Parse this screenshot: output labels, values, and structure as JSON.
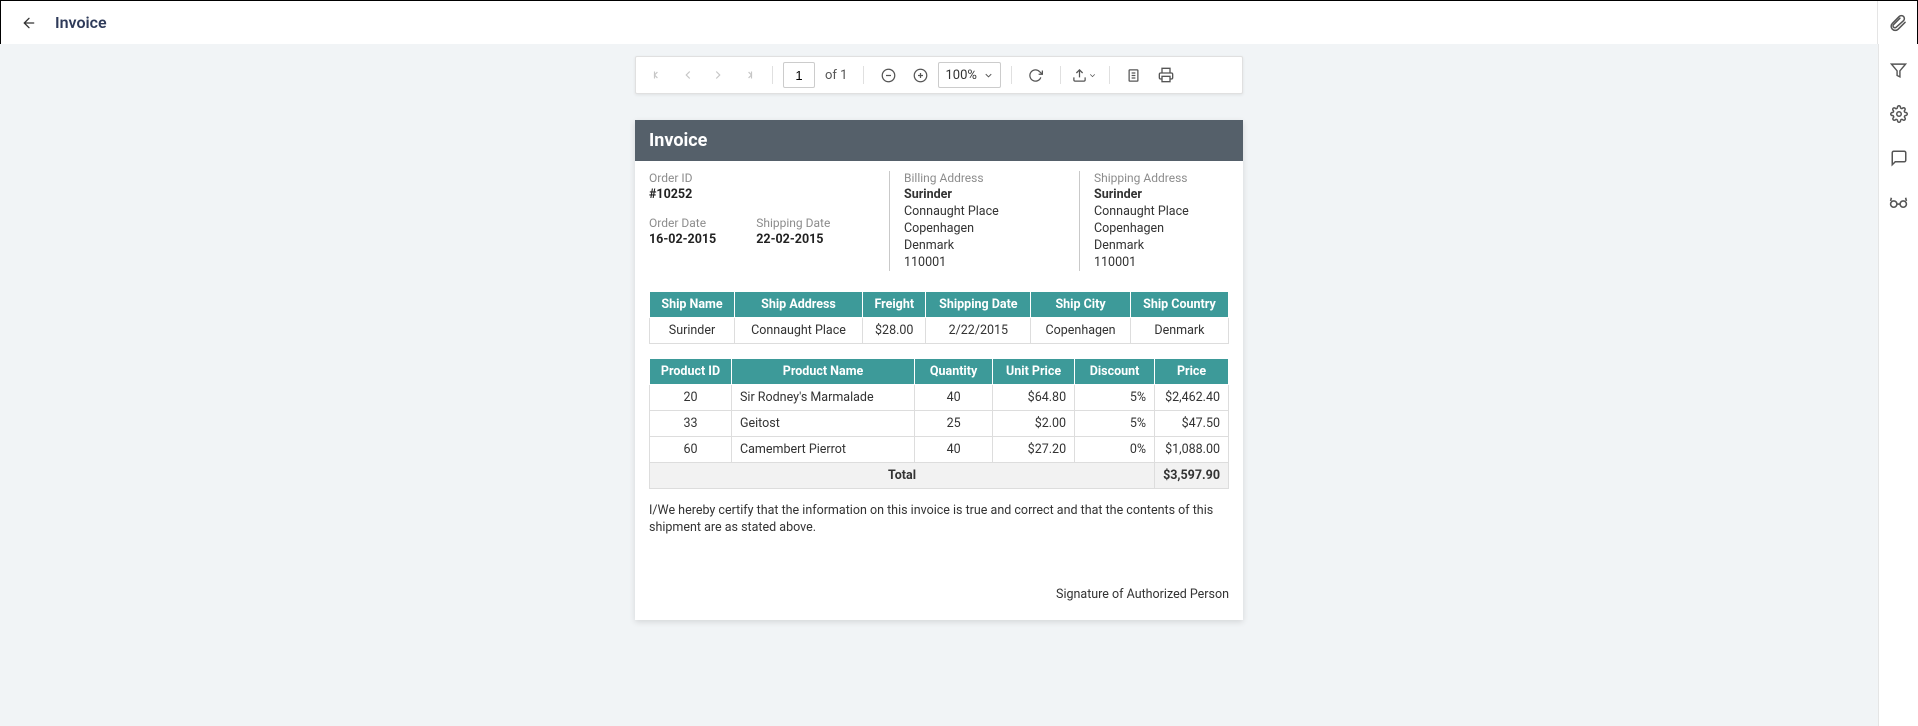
{
  "app": {
    "title": "Invoice"
  },
  "toolbar": {
    "page_current": "1",
    "page_of": "of 1",
    "zoom": "100%"
  },
  "invoice": {
    "title": "Invoice",
    "order_id_label": "Order ID",
    "order_id": "#10252",
    "order_date_label": "Order Date",
    "order_date": "16-02-2015",
    "shipping_date_label": "Shipping Date",
    "shipping_date": "22-02-2015",
    "billing_label": "Billing Address",
    "shipping_label": "Shipping Address",
    "billing": {
      "name": "Surinder",
      "line1": "Connaught Place",
      "city": "Copenhagen",
      "country": "Denmark",
      "postal": "110001"
    },
    "shipping": {
      "name": "Surinder",
      "line1": "Connaught Place",
      "city": "Copenhagen",
      "country": "Denmark",
      "postal": "110001"
    },
    "ship_table": {
      "headers": {
        "name": "Ship Name",
        "address": "Ship Address",
        "freight": "Freight",
        "date": "Shipping Date",
        "city": "Ship City",
        "country": "Ship Country"
      },
      "row": {
        "name": "Surinder",
        "address": "Connaught Place",
        "freight": "$28.00",
        "date": "2/22/2015",
        "city": "Copenhagen",
        "country": "Denmark"
      }
    },
    "items_table": {
      "headers": {
        "pid": "Product ID",
        "pname": "Product Name",
        "qty": "Quantity",
        "unit": "Unit Price",
        "disc": "Discount",
        "price": "Price"
      },
      "rows": [
        {
          "pid": "20",
          "pname": "Sir Rodney's Marmalade",
          "qty": "40",
          "unit": "$64.80",
          "disc": "5%",
          "price": "$2,462.40"
        },
        {
          "pid": "33",
          "pname": "Geitost",
          "qty": "25",
          "unit": "$2.00",
          "disc": "5%",
          "price": "$47.50"
        },
        {
          "pid": "60",
          "pname": "Camembert Pierrot",
          "qty": "40",
          "unit": "$27.20",
          "disc": "0%",
          "price": "$1,088.00"
        }
      ],
      "total_label": "Total",
      "total": "$3,597.90"
    },
    "certification": "I/We hereby certify that the information on this invoice is true and correct and that the contents of this shipment are as stated above.",
    "signature": "Signature of Authorized Person"
  }
}
